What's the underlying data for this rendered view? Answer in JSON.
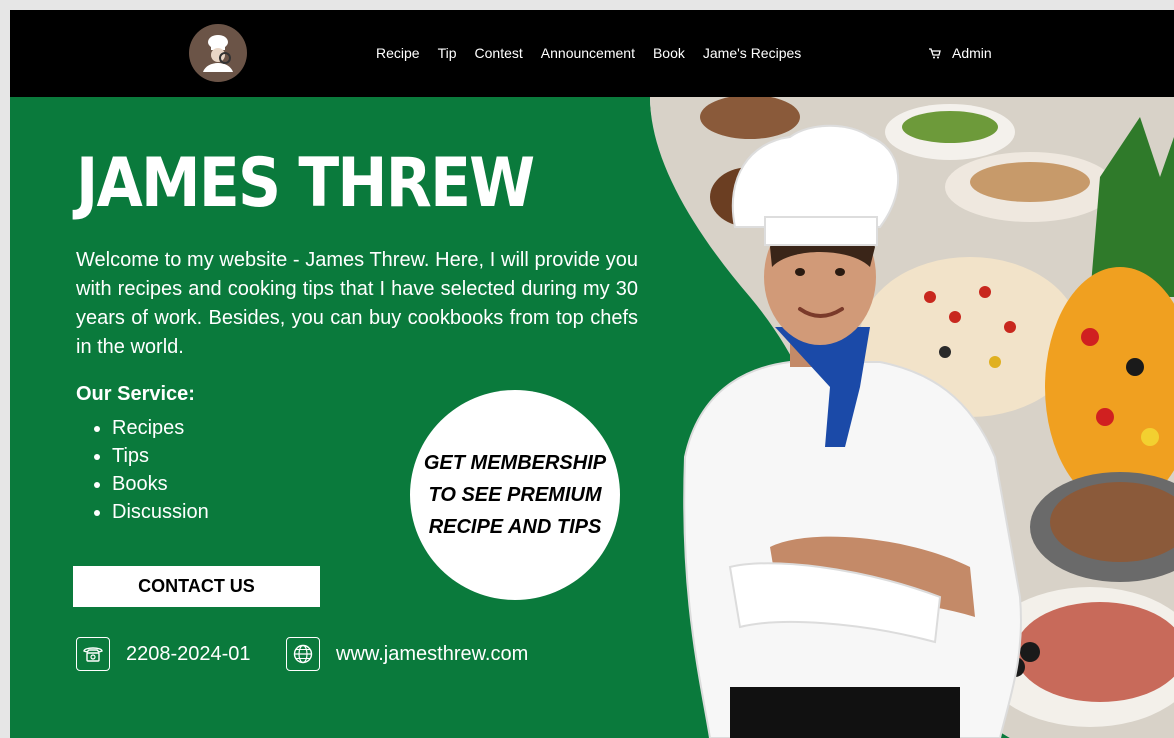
{
  "nav": {
    "items": [
      "Recipe",
      "Tip",
      "Contest",
      "Announcement",
      "Book",
      "Jame's Recipes"
    ],
    "admin_label": "Admin"
  },
  "hero": {
    "title": "JAMES THREW",
    "intro": "Welcome to my website - James Threw. Here, I will provide you with recipes and cooking tips that I have selected during my 30 years of work. Besides, you can buy cookbooks from top chefs in the world.",
    "services_title": "Our Service:",
    "services": [
      "Recipes",
      "Tips",
      "Books",
      "Discussion"
    ],
    "contact_label": "CONTACT US",
    "phone": "2208-2024-01",
    "website": "www.jamesthrew.com"
  },
  "badge": {
    "text": "GET MEMBERSHIP TO SEE PREMIUM RECIPE AND TIPS"
  },
  "colors": {
    "brand_green": "#0a7a3c",
    "topbar": "#000000",
    "text_light": "#ffffff"
  },
  "icons": [
    "chef-logo-icon",
    "cart-icon",
    "phone-icon",
    "globe-icon"
  ]
}
